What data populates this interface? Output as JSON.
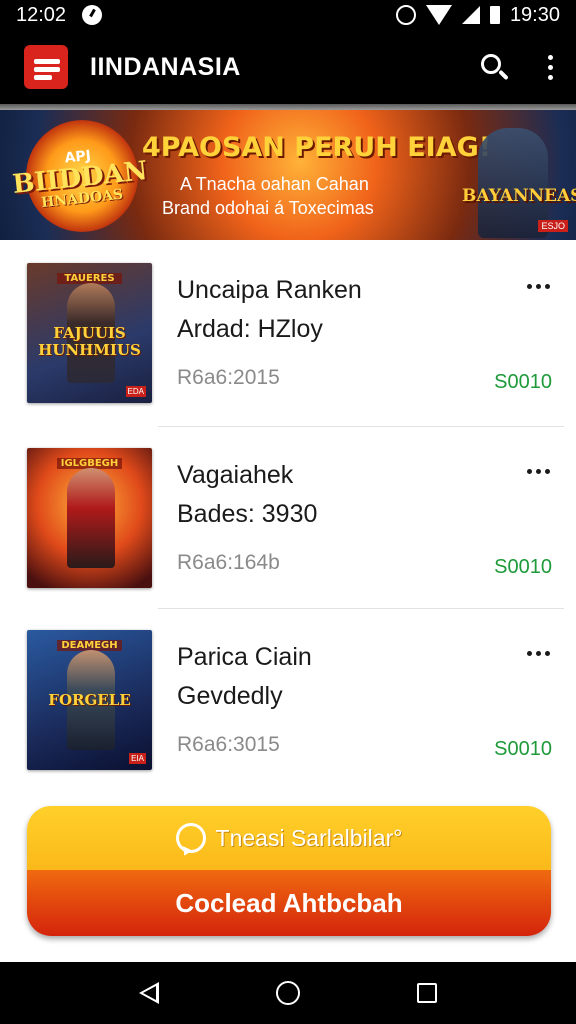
{
  "status_bar": {
    "time": "12:02",
    "clock": "19:30",
    "icons": [
      "notification-icon",
      "alarm-icon",
      "wifi-icon",
      "signal-icon",
      "battery-icon"
    ]
  },
  "app_bar": {
    "title": "IINDANASIA",
    "logo_icon": "app-logo-icon",
    "actions": [
      "search-icon",
      "more-vert-icon"
    ]
  },
  "banner": {
    "badge_top": "APJ",
    "badge_main": "BIIDDAN",
    "badge_sub": "HNADOAS",
    "headline": "4PAOSAN PERUH EIAG!",
    "subline1": "A Tnacha oahan Cahan",
    "subline2": "Brand odohai á Toxecimas",
    "right_title": "BAYANNEAS",
    "tag": "ESJO"
  },
  "items": [
    {
      "title": "Uncaipa Ranken",
      "subtitle": "Ardad: HZloy",
      "meta": "R6a6:2015",
      "price": "S0010",
      "thumb_caption": "FAJUUIS HUNHMIUS",
      "thumb_top": "TAUERES",
      "thumb_tag": "EDA"
    },
    {
      "title": "Vagaiahek",
      "subtitle": "Bades: 3930",
      "meta": "R6a6:164b",
      "price": "S0010",
      "thumb_caption": "",
      "thumb_top": "IGLGBEGH",
      "thumb_tag": ""
    },
    {
      "title": "Parica Ciain",
      "subtitle": "Gevdedly",
      "meta": "R6a6:3015",
      "price": "S0010",
      "thumb_caption": "FORGELE",
      "thumb_top": "DEAMEGH",
      "thumb_tag": "EIA"
    }
  ],
  "cta": {
    "upper_label": "Tneasi Sarlalbilar°",
    "lower_label": "Coclead Ahtbcbah",
    "icon": "whatsapp-icon",
    "upper_color": "#fcc21e",
    "lower_color": "#e0400e"
  },
  "nav_bar": {
    "buttons": [
      "back-icon",
      "home-icon",
      "recents-icon"
    ]
  },
  "colors": {
    "price_green": "#1e9a3a",
    "app_bar": "#000000",
    "logo_red": "#d8241c"
  }
}
